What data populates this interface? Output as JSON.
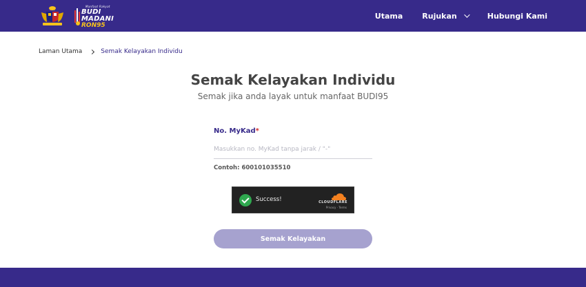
{
  "header": {
    "brand": {
      "tagline": "Manfaat Rakyat",
      "line1": "BUDI",
      "line2": "MADANI",
      "line3": "RON95"
    },
    "nav": [
      {
        "label": "Utama"
      },
      {
        "label": "Rujukan"
      },
      {
        "label": "Hubungi Kami"
      }
    ]
  },
  "breadcrumb": {
    "home": "Laman Utama",
    "current": "Semak Kelayakan Individu"
  },
  "page": {
    "title": "Semak Kelayakan Individu",
    "subtitle": "Semak jika anda layak untuk manfaat BUDI95"
  },
  "form": {
    "mykad_label": "No. MyKad",
    "required_mark": "*",
    "mykad_value": "",
    "mykad_placeholder": "Masukkan no. MyKad tanpa jarak / \"-\"",
    "example": "Contoh: 600101035510",
    "submit_label": "Semak Kelayakan"
  },
  "captcha": {
    "status": "Success!",
    "brand": "CLOUDFLARE",
    "links": [
      "Privacy",
      "Terms"
    ]
  },
  "colors": {
    "primary": "#372a8a",
    "button_disabled": "#a6a2cf",
    "success": "#2fa84f",
    "cloudflare_orange": "#f48120"
  }
}
